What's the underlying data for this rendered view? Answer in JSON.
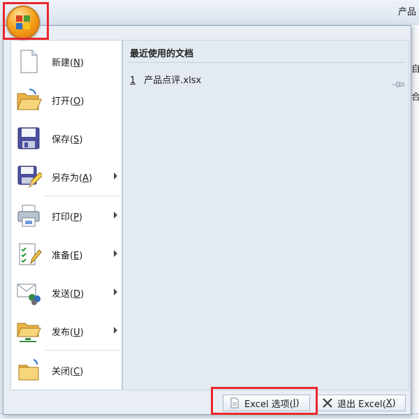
{
  "window": {
    "title_fragment": "产品"
  },
  "right_edge": {
    "fragments": [
      "自",
      "合"
    ]
  },
  "menu": {
    "items": [
      {
        "label": "新建(",
        "key": "N",
        "suffix": ")",
        "submenu": false
      },
      {
        "label": "打开(",
        "key": "O",
        "suffix": ")",
        "submenu": false
      },
      {
        "label": "保存(",
        "key": "S",
        "suffix": ")",
        "submenu": false
      },
      {
        "label": "另存为(",
        "key": "A",
        "suffix": ")",
        "submenu": true
      },
      {
        "label": "打印(",
        "key": "P",
        "suffix": ")",
        "submenu": true
      },
      {
        "label": "准备(",
        "key": "E",
        "suffix": ")",
        "submenu": true
      },
      {
        "label": "发送(",
        "key": "D",
        "suffix": ")",
        "submenu": true
      },
      {
        "label": "发布(",
        "key": "U",
        "suffix": ")",
        "submenu": true
      },
      {
        "label": "关闭(",
        "key": "C",
        "suffix": ")",
        "submenu": false
      }
    ]
  },
  "recent": {
    "title": "最近使用的文档",
    "files": [
      {
        "index": "1",
        "name": "产品点评.xlsx"
      }
    ]
  },
  "footer": {
    "options_label": "Excel 选项(",
    "options_key": "I",
    "exit_label": "退出 Excel(",
    "exit_key": "X",
    "close_paren": ")"
  },
  "colors": {
    "highlight": "#e8262b",
    "office_orange": "#f6a21c"
  }
}
